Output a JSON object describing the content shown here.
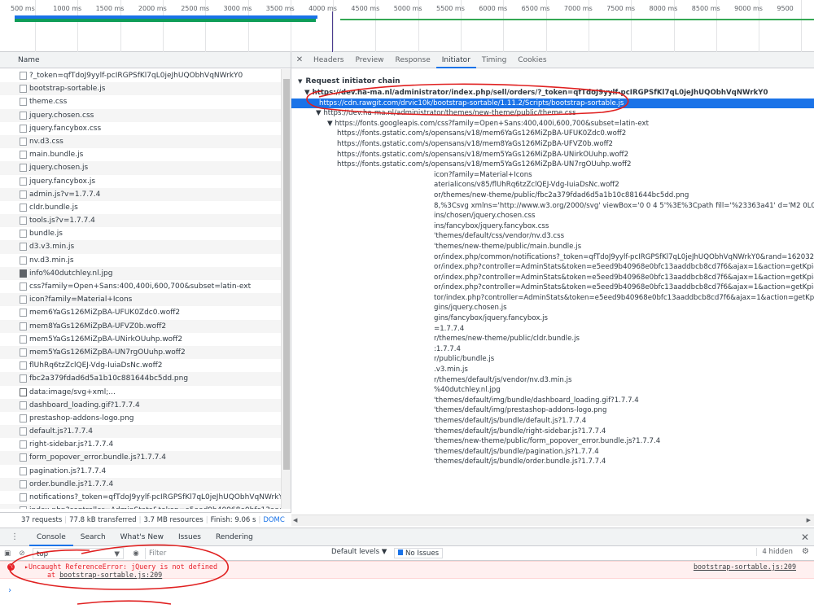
{
  "timeline": {
    "ticks": [
      "500 ms",
      "1000 ms",
      "1500 ms",
      "2000 ms",
      "2500 ms",
      "3000 ms",
      "3500 ms",
      "4000 ms",
      "4500 ms",
      "5000 ms",
      "5500 ms",
      "6000 ms",
      "6500 ms",
      "7000 ms",
      "7500 ms",
      "8000 ms",
      "8500 ms",
      "9000 ms",
      "9500"
    ]
  },
  "requests": {
    "header": "Name",
    "items": [
      "?_token=qfTdoJ9yylf-pcIRGPSfKl7qL0jeJhUQObhVqNWrkY0",
      "bootstrap-sortable.js",
      "theme.css",
      "jquery.chosen.css",
      "jquery.fancybox.css",
      "nv.d3.css",
      "main.bundle.js",
      "jquery.chosen.js",
      "jquery.fancybox.js",
      "admin.js?v=1.7.7.4",
      "cldr.bundle.js",
      "tools.js?v=1.7.7.4",
      "bundle.js",
      "d3.v3.min.js",
      "nv.d3.min.js",
      "info%40dutchley.nl.jpg",
      "css?family=Open+Sans:400,400i,600,700&subset=latin-ext",
      "icon?family=Material+Icons",
      "mem6YaGs126MiZpBA-UFUK0Zdc0.woff2",
      "mem8YaGs126MiZpBA-UFVZ0b.woff2",
      "mem5YaGs126MiZpBA-UNirkOUuhp.woff2",
      "mem5YaGs126MiZpBA-UN7rgOUuhp.woff2",
      "flUhRq6tzZclQEJ-Vdg-IuiaDsNc.woff2",
      "fbc2a379fdad6d5a1b10c881644bc5dd.png",
      "data:image/svg+xml;...",
      "dashboard_loading.gif?1.7.7.4",
      "prestashop-addons-logo.png",
      "default.js?1.7.7.4",
      "right-sidebar.js?1.7.7.4",
      "form_popover_error.bundle.js?1.7.7.4",
      "pagination.js?1.7.7.4",
      "order.bundle.js?1.7.7.4",
      "notifications?_token=qfTdoJ9yylf-pcIRGPSfKl7qL0jeJhUQObhVqNWrkY0&rar",
      "index.php?controller=AdminStats&token=e5eed9b40968e0bfc13aaddbcb8cd7f6&ajax=1&action=getKpi&kpi=conversion_rate&r"
    ]
  },
  "status": {
    "requests": "37 requests",
    "transferred": "77.8 kB transferred",
    "resources": "3.7 MB resources",
    "finish": "Finish: 9.06 s",
    "dom": "DOMC"
  },
  "detail_tabs": [
    "Headers",
    "Preview",
    "Response",
    "Initiator",
    "Timing",
    "Cookies"
  ],
  "initiator": {
    "title": "Request initiator chain",
    "lines": [
      "▼ https://dev.ha-ma.nl/administrator/index.php/sell/orders/?_token=qfTdoJ9yylf-pcIRGPSfKl7qL0jeJhUQObhVqNWrkY0",
      "https://cdn.rawgit.com/drvic10k/bootstrap-sortable/1.11.2/Scripts/bootstrap-sortable.js",
      "▼ https://dev.ha-ma.nl/administrator/themes/new-theme/public/theme.css",
      "▼ https://fonts.googleapis.com/css?family=Open+Sans:400,400i,600,700&subset=latin-ext",
      "https://fonts.gstatic.com/s/opensans/v18/mem6YaGs126MiZpBA-UFUK0Zdc0.woff2",
      "https://fonts.gstatic.com/s/opensans/v18/mem8YaGs126MiZpBA-UFVZ0b.woff2",
      "https://fonts.gstatic.com/s/opensans/v18/mem5YaGs126MiZpBA-UNirkOUuhp.woff2",
      "https://fonts.gstatic.com/s/opensans/v18/mem5YaGs126MiZpBA-UN7rgOUuhp.woff2",
      "icon?family=Material+Icons",
      "aterialicons/v85/flUhRq6tzZclQEJ-Vdg-IuiaDsNc.woff2",
      "or/themes/new-theme/public/fbc2a379fdad6d5a1b10c881644bc5dd.png",
      "8,%3Csvg xmlns='http://www.w3.org/2000/svg' viewBox='0 0 4 5'%3E%3Cpath fill='%23363a41' d='M2 0L0 2h4zm",
      "ins/chosen/jquery.chosen.css",
      "ins/fancybox/jquery.fancybox.css",
      "'themes/default/css/vendor/nv.d3.css",
      "'themes/new-theme/public/main.bundle.js",
      "or/index.php/common/notifications?_token=qfTdoJ9yylf-pcIRGPSfKl7qL0jeJhUQObhVqNWrkY0&rand=162032199",
      "or/index.php?controller=AdminStats&token=e5eed9b40968e0bfc13aaddbcb8cd7f6&ajax=1&action=getKpi&kpi=",
      "or/index.php?controller=AdminStats&token=e5eed9b40968e0bfc13aaddbcb8cd7f6&ajax=1&action=getKpi&kpi=",
      "or/index.php?controller=AdminStats&token=e5eed9b40968e0bfc13aaddbcb8cd7f6&ajax=1&action=getKpi&kpi=",
      "tor/index.php?controller=AdminStats&token=e5eed9b40968e0bfc13aaddbcb8cd7f6&ajax=1&action=getKpi&kpi=",
      "gins/jquery.chosen.js",
      "gins/fancybox/jquery.fancybox.js",
      "=1.7.7.4",
      "r/themes/new-theme/public/cldr.bundle.js",
      ":1.7.7.4",
      "r/public/bundle.js",
      ".v3.min.js",
      "r/themes/default/js/vendor/nv.d3.min.js",
      "%40dutchley.nl.jpg",
      "'themes/default/img/bundle/dashboard_loading.gif?1.7.7.4",
      "'themes/default/img/prestashop-addons-logo.png",
      "'themes/default/js/bundle/default.js?1.7.7.4",
      "'themes/default/js/bundle/right-sidebar.js?1.7.7.4",
      "'themes/new-theme/public/form_popover_error.bundle.js?1.7.7.4",
      "'themes/default/js/bundle/pagination.js?1.7.7.4",
      "'themes/default/js/bundle/order.bundle.js?1.7.7.4"
    ],
    "partial": "'fonts.googlea"
  },
  "drawer": {
    "tabs": [
      "Console",
      "Search",
      "What's New",
      "Issues",
      "Rendering"
    ],
    "context": "top",
    "filter_placeholder": "Filter",
    "levels": "Default levels ▼",
    "issues": "No Issues",
    "hidden": "4 hidden",
    "error": {
      "message": "▸Uncaught ReferenceError: jQuery is not defined",
      "at_prefix": "at",
      "at_link": "bootstrap-sortable.js:209",
      "source": "bootstrap-sortable.js:209"
    },
    "prompt": "›"
  },
  "colors": {
    "accent": "#1a73e8",
    "error": "#e8202a",
    "annotation": "#e02020"
  }
}
